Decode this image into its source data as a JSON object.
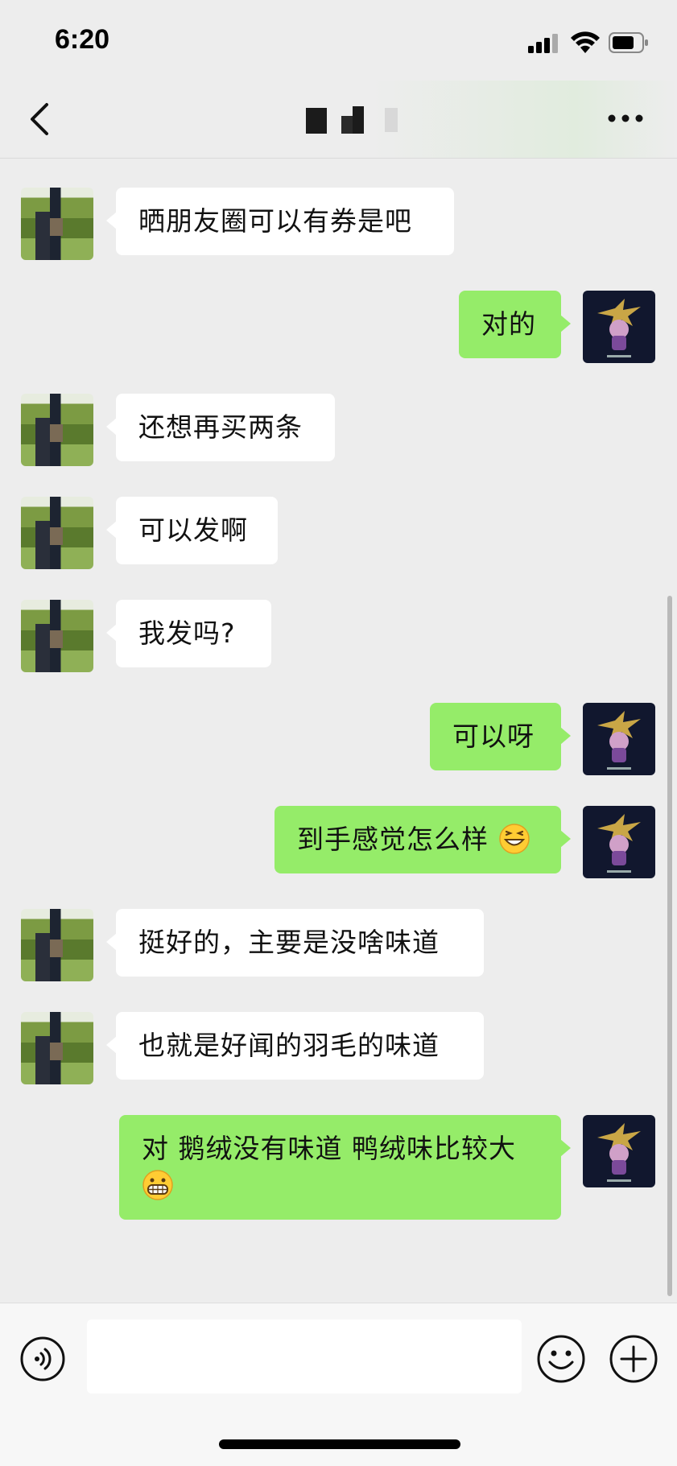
{
  "status": {
    "time": "6:20"
  },
  "messages": [
    {
      "side": "left",
      "text": "晒朋友圈可以有券是吧"
    },
    {
      "side": "right",
      "text": "对的"
    },
    {
      "side": "left",
      "text": "还想再买两条"
    },
    {
      "side": "left",
      "text": "可以发啊"
    },
    {
      "side": "left",
      "text": "我发吗?"
    },
    {
      "side": "right",
      "text": "可以呀"
    },
    {
      "side": "right",
      "text": "到手感觉怎么样",
      "emoji": "grinning-squint-emoji"
    },
    {
      "side": "left",
      "text": "挺好的，主要是没啥味道"
    },
    {
      "side": "left",
      "text": "也就是好闻的羽毛的味道"
    },
    {
      "side": "right",
      "text": "对 鹅绒没有味道 鸭绒味比较大",
      "emoji": "grinning-teeth-emoji"
    }
  ],
  "input": {
    "placeholder": ""
  },
  "icons": {
    "back": "chevron-left-icon",
    "more": "more-dots-icon",
    "voice": "voice-icon",
    "emoji": "emoji-icon",
    "plus": "plus-icon"
  },
  "colors": {
    "background": "#ededed",
    "bubble_self": "#95ec69",
    "bubble_other": "#ffffff"
  }
}
